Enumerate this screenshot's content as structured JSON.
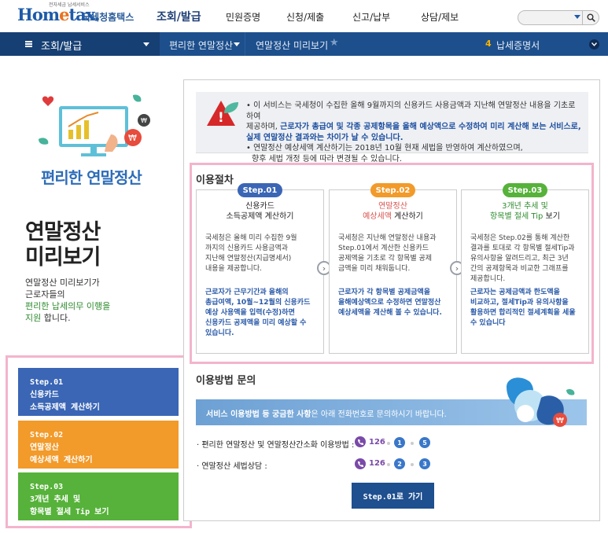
{
  "header": {
    "logo_small": "전자세금 납세서비스",
    "logo_text_a": "Hom",
    "logo_text_e": "e",
    "logo_text_b": "tax.",
    "logo_kr": "국세청홈택스",
    "nav": [
      "조회/발급",
      "민원증명",
      "신청/제출",
      "신고/납부",
      "상담/제보"
    ]
  },
  "subnav": {
    "menu_label": "조회/발급",
    "crumb1": "편리한 연말정산",
    "crumb2": "연말정산 미리보기",
    "quick_num": "4",
    "quick_label": "납세증명서"
  },
  "left": {
    "pt_title": "편리한 연말정산",
    "big_title_1": "연말정산",
    "big_title_2": "미리보기",
    "desc_1": "연말정산 미리보기가",
    "desc_2": "근로자들의",
    "desc_3": "편리한 납세의무 이행을",
    "desc_4": "지원",
    "desc_4b": " 합니다.",
    "buttons": [
      {
        "l1": "Step.01",
        "l2": "신용카드",
        "l3": "소득공제액 계산하기",
        "color": "#3a66b5"
      },
      {
        "l1": "Step.02",
        "l2": "연말정산",
        "l3": "예상세액 계산하기",
        "color": "#f29a2a"
      },
      {
        "l1": "Step.03",
        "l2": "3개년 추세 및",
        "l3": "항목별 절세 Tip 보기",
        "color": "#56b23a"
      }
    ]
  },
  "notice": {
    "line1": "• 이 서비스는 국세청이 수집한 올해 9월까지의 신용카드 사용금액과 지난해 연말정산 내용을 기초로 하여",
    "line2a": "제공하며, ",
    "line2b": "근로자가 총급여 및 각종 공제항목을 올해 예상액으로 수정하여 미리 계산해 보는 서비스로,",
    "line3": "실제 연말정산 결과와는 차이가 날 수 있습니다.",
    "line4": "• 연말정산 예상세액 계산하기는 2018년 10월 현재 세법을 반영하여 계산하였으며,",
    "line5": "향후 세법 개정 등에 따라 변경될 수 있습니다."
  },
  "procedure": {
    "title": "이용절차",
    "steps": [
      {
        "pill": "Step.01",
        "color": "#3a66b5",
        "t1": "신용카드",
        "t2": "소득공제액 계산하기",
        "body": [
          "국세청은 올해 미리 수집한 9월",
          "까지의 신용카드 사용금액과",
          "지난해 연말정산(지급명세서)",
          "내용을 제공합니다."
        ],
        "note": [
          "근로자가 근무기간과 올해의",
          "총급여액, 10월~12월의 신용카드",
          "예상 사용액을 입력(수정)하면",
          "신용카드 공제액을 미리 예상할 수",
          "있습니다."
        ]
      },
      {
        "pill": "Step.02",
        "color": "#f29a2a",
        "t1": "연말정산",
        "t2a": "예상세액",
        "t2b": " 계산하기",
        "body": [
          "국세청은 지난해 연말정산 내용과",
          "Step.01에서 계산한 신용카드",
          "공제액을 기초로 각 항목별 공제",
          "금액을 미리 채워둡니다."
        ],
        "note": [
          "근로자가 각 항목별 공제금액을",
          "올해예상액으로 수정하면 연말정산",
          "예상세액을 계산해 볼 수 있습니다."
        ]
      },
      {
        "pill": "Step.03",
        "color": "#56b23a",
        "t1": "3개년 추세 및",
        "t2a": "항목별 절세 Tip",
        "t2b": " 보기",
        "body": [
          "국세청은 Step.02를 통해 계산한",
          "결과를 토대로 각 항목별 절세Tip과",
          "유의사항을 알려드리고, 최근 3년",
          "간의 공제항목과 비교한 그래프를",
          "제공합니다."
        ],
        "note": [
          "근로자는 공제금액과 한도액을",
          "비교하고, 절세Tip과 유의사항을",
          "활용하면 합리적인 절세계획을 세울",
          "수 있습니다"
        ]
      }
    ]
  },
  "inquiry": {
    "title": "이용방법 문의",
    "banner_bold": "서비스 이용방법 등 궁금한 사항",
    "banner_rest": "은 아래 전화번호로 문의하시기 바랍니다.",
    "row1_label": "· 편리한 연말정산 및 연말정산간소화 이용방법 :",
    "row1_num": "126",
    "row1_seq": [
      "1",
      "5"
    ],
    "row2_label": "· 연말정산 세법상담 :",
    "row2_num": "126",
    "row2_seq": [
      "2",
      "3"
    ],
    "go_button": "Step.01로 가기"
  }
}
